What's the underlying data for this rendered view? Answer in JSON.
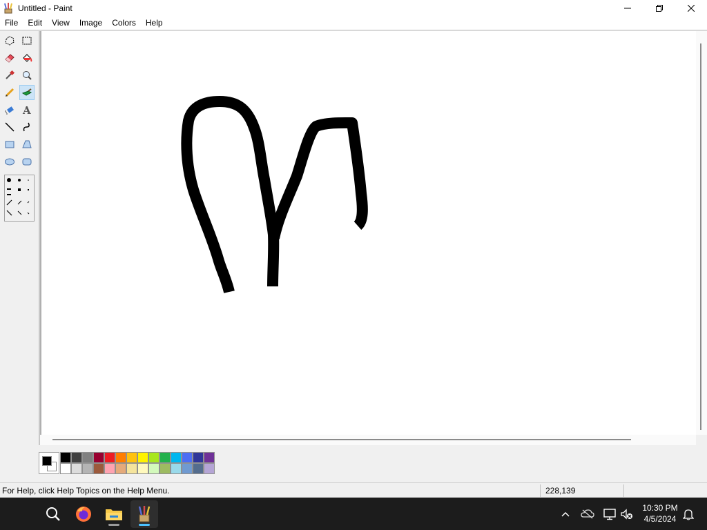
{
  "window": {
    "title": "Untitled - Paint",
    "app_icon": "paint-brush-icon",
    "controls": [
      "minimize-icon",
      "maximize-icon",
      "close-icon"
    ]
  },
  "menu": [
    "File",
    "Edit",
    "View",
    "Image",
    "Colors",
    "Help"
  ],
  "toolbox": {
    "tools": [
      {
        "name": "free-form-select",
        "icon": "free-form-select-icon"
      },
      {
        "name": "select",
        "icon": "rect-select-icon"
      },
      {
        "name": "eraser",
        "icon": "eraser-icon"
      },
      {
        "name": "fill",
        "icon": "fill-bucket-icon"
      },
      {
        "name": "pick-color",
        "icon": "eyedropper-icon"
      },
      {
        "name": "magnifier",
        "icon": "magnifier-icon"
      },
      {
        "name": "pencil",
        "icon": "pencil-icon"
      },
      {
        "name": "brush",
        "icon": "brush-icon",
        "active": true
      },
      {
        "name": "airbrush",
        "icon": "airbrush-icon"
      },
      {
        "name": "text",
        "icon": "text-icon"
      },
      {
        "name": "line",
        "icon": "line-icon"
      },
      {
        "name": "curve",
        "icon": "curve-icon"
      },
      {
        "name": "rectangle",
        "icon": "rectangle-icon"
      },
      {
        "name": "polygon",
        "icon": "polygon-icon"
      },
      {
        "name": "ellipse",
        "icon": "ellipse-icon"
      },
      {
        "name": "rounded-rectangle",
        "icon": "rounded-rectangle-icon"
      }
    ],
    "brush_options": "brush-shape-options"
  },
  "palette": {
    "foreground": "#000000",
    "background": "#ffffff",
    "row1": [
      "#000000",
      "#404040",
      "#808080",
      "#990030",
      "#ed1c24",
      "#ff7e00",
      "#ffc20e",
      "#fff200",
      "#a8e61d",
      "#22b14c",
      "#00b7ef",
      "#4d6df3",
      "#2f3699",
      "#6f3198"
    ],
    "row2": [
      "#ffffff",
      "#dcdcdc",
      "#b4b4b4",
      "#9c5a3c",
      "#ffa3b1",
      "#e5aa7a",
      "#f5e49c",
      "#fff9bd",
      "#d3f9bc",
      "#9dbb61",
      "#99d9ea",
      "#709ad1",
      "#546d8e",
      "#b5a5d5"
    ]
  },
  "canvas": {
    "stroke_color": "#000000",
    "content": "hand-drawn-stroke"
  },
  "status": {
    "help_text": "For Help, click Help Topics on the Help Menu.",
    "coords": "228,139"
  },
  "taskbar": {
    "apps": [
      {
        "name": "search",
        "icon": "search-icon"
      },
      {
        "name": "firefox",
        "icon": "firefox-icon"
      },
      {
        "name": "file-explorer",
        "icon": "folder-icon"
      },
      {
        "name": "paint",
        "icon": "paint-icon",
        "active": true
      }
    ],
    "tray": [
      "chevron-up-icon",
      "onedrive-icon",
      "network-icon",
      "volume-muted-icon"
    ],
    "time": "10:30 PM",
    "date": "4/5/2024",
    "notification_icon": "bell-icon"
  }
}
